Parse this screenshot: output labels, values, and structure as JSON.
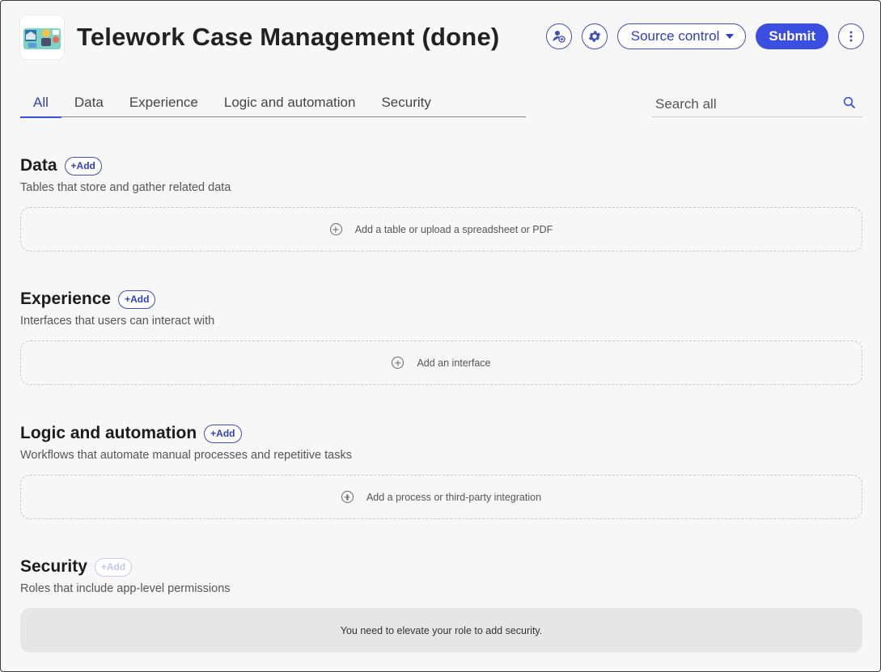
{
  "app": {
    "title": "Telework Case Management (done)",
    "icon": "app-illustration-icon"
  },
  "header": {
    "invite_icon": "user-add-icon",
    "settings_icon": "gear-icon",
    "source_control_label": "Source control",
    "submit_label": "Submit",
    "more_icon": "more-vertical-icon"
  },
  "tabs": [
    {
      "label": "All",
      "active": true
    },
    {
      "label": "Data",
      "active": false
    },
    {
      "label": "Experience",
      "active": false
    },
    {
      "label": "Logic and automation",
      "active": false
    },
    {
      "label": "Security",
      "active": false
    }
  ],
  "search": {
    "placeholder": "Search all",
    "icon": "search-icon"
  },
  "sections": {
    "data": {
      "title": "Data",
      "add_label": "+Add",
      "description": "Tables that store and gather related data",
      "empty_text": "Add a table or upload a spreadsheet or PDF"
    },
    "experience": {
      "title": "Experience",
      "add_label": "+Add",
      "description": "Interfaces that users can interact with",
      "empty_text": "Add an interface"
    },
    "logic": {
      "title": "Logic and automation",
      "add_label": "+Add",
      "description": "Workflows that automate manual processes and repetitive tasks",
      "empty_text": "Add a process or third-party integration"
    },
    "security": {
      "title": "Security",
      "add_label": "+Add",
      "add_disabled": true,
      "description": "Roles that include app-level permissions",
      "notice_text": "You need to elevate your role to add security."
    }
  },
  "colors": {
    "accent": "#3a4fe0",
    "background": "#f7f7f8",
    "text": "#1f1f1f"
  }
}
